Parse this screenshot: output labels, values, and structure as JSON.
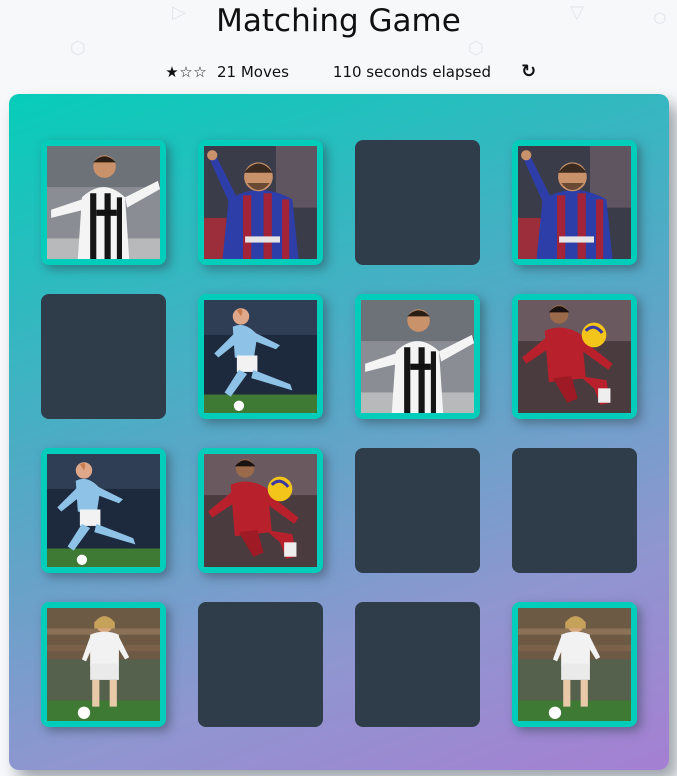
{
  "title": "Matching Game",
  "score": {
    "stars": [
      "★",
      "☆",
      "☆"
    ],
    "moves_text": "21 Moves",
    "timer_text": "110 seconds elapsed",
    "restart_icon": "↻"
  },
  "colors": {
    "card_closed": "#2e3d49",
    "card_open": "#02ccba",
    "deck_gradient_start": "#06cdb9",
    "deck_gradient_end": "#a57fd2"
  },
  "cards": [
    {
      "state": "open",
      "player": "ronaldo-juventus"
    },
    {
      "state": "open",
      "player": "messi-barcelona"
    },
    {
      "state": "closed",
      "player": ""
    },
    {
      "state": "open",
      "player": "messi-barcelona"
    },
    {
      "state": "closed",
      "player": ""
    },
    {
      "state": "open",
      "player": "de-bruyne-man-city"
    },
    {
      "state": "open",
      "player": "ronaldo-juventus"
    },
    {
      "state": "open",
      "player": "salah-liverpool"
    },
    {
      "state": "open",
      "player": "de-bruyne-man-city"
    },
    {
      "state": "open",
      "player": "salah-liverpool"
    },
    {
      "state": "closed",
      "player": ""
    },
    {
      "state": "closed",
      "player": ""
    },
    {
      "state": "open",
      "player": "modric-real-madrid"
    },
    {
      "state": "closed",
      "player": ""
    },
    {
      "state": "closed",
      "player": ""
    },
    {
      "state": "open",
      "player": "modric-real-madrid"
    }
  ]
}
